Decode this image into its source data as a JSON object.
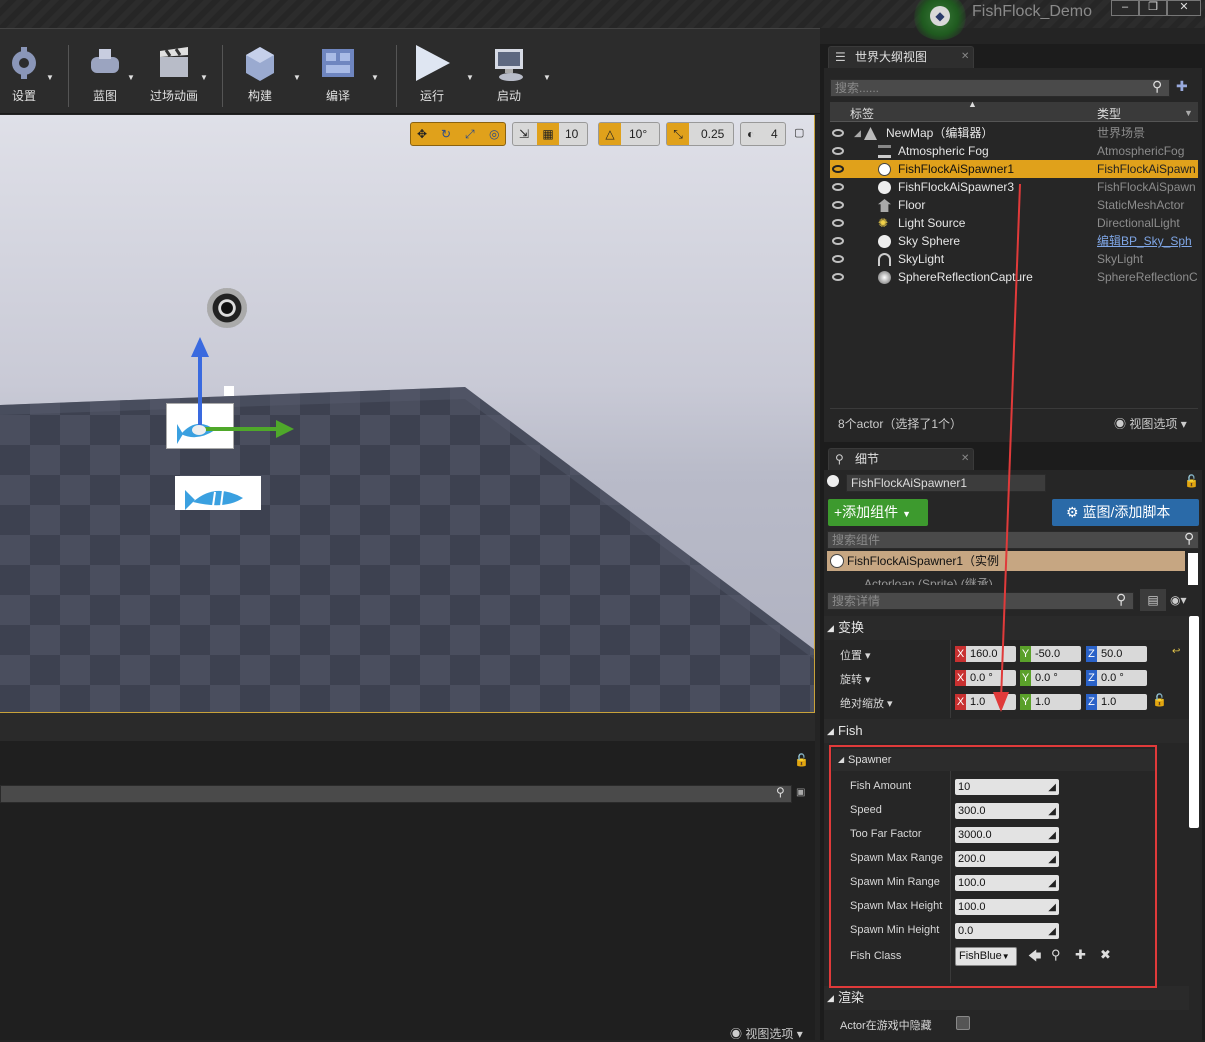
{
  "app": {
    "title": "FishFlock_Demo",
    "controls": [
      "‒",
      "❐",
      "✕"
    ]
  },
  "toolbar": {
    "buttons": [
      {
        "label": "设置",
        "icon": "settings-icon"
      },
      {
        "label": "蓝图",
        "icon": "blueprint-icon"
      },
      {
        "label": "过场动画",
        "icon": "cinematics-icon"
      },
      {
        "label": "构建",
        "icon": "build-icon"
      },
      {
        "label": "编译",
        "icon": "compile-icon"
      },
      {
        "label": "运行",
        "icon": "play-icon"
      },
      {
        "label": "启动",
        "icon": "launch-icon"
      }
    ]
  },
  "viewport": {
    "grid_snap": "10",
    "rotation_snap": "10°",
    "scale_snap": "0.25",
    "camera_speed": "4"
  },
  "outliner": {
    "tab_label": "世界大纲视图",
    "search_placeholder": "搜索......",
    "col_label": "标签",
    "col_type": "类型",
    "items": [
      {
        "name": "NewMap（编辑器）",
        "type": "世界场景"
      },
      {
        "name": "Atmospheric Fog",
        "type": "AtmosphericFog"
      },
      {
        "name": "FishFlockAiSpawner1",
        "type": "FishFlockAiSpawn"
      },
      {
        "name": "FishFlockAiSpawner3",
        "type": "FishFlockAiSpawn"
      },
      {
        "name": "Floor",
        "type": "StaticMeshActor"
      },
      {
        "name": "Light Source",
        "type": "DirectionalLight"
      },
      {
        "name": "Sky Sphere",
        "type": "编辑BP_Sky_Sph"
      },
      {
        "name": "SkyLight",
        "type": "SkyLight"
      },
      {
        "name": "SphereReflectionCapture",
        "type": "SphereReflectionC"
      }
    ],
    "status": "8个actor（选择了1个）",
    "view_options": "视图选项"
  },
  "details": {
    "tab_label": "细节",
    "actor_name": "FishFlockAiSpawner1",
    "add_component": "+添加组件",
    "blueprint_btn": "蓝图/添加脚本",
    "search_components": "搜索组件",
    "component_root": "FishFlockAiSpawner1（实例",
    "component_child": "Actorloan (Sprite) (继承)",
    "search_details": "搜索详情",
    "transform": {
      "section": "变换",
      "location_label": "位置",
      "rotation_label": "旋转",
      "scale_label": "绝对缩放",
      "location": {
        "x": "160.0",
        "y": "-50.0",
        "z": "50.0"
      },
      "rotation": {
        "x": "0.0 °",
        "y": "0.0 °",
        "z": "0.0 °"
      },
      "scale": {
        "x": "1.0",
        "y": "1.0",
        "z": "1.0"
      }
    },
    "fish_section": "Fish",
    "spawner_section": "Spawner",
    "props": [
      {
        "label": "Fish Amount",
        "value": "10"
      },
      {
        "label": "Speed",
        "value": "300.0"
      },
      {
        "label": "Too Far Factor",
        "value": "3000.0"
      },
      {
        "label": "Spawn Max Range",
        "value": "200.0"
      },
      {
        "label": "Spawn Min Range",
        "value": "100.0"
      },
      {
        "label": "Spawn Max Height",
        "value": "100.0"
      },
      {
        "label": "Spawn Min Height",
        "value": "0.0"
      }
    ],
    "fish_class_label": "Fish Class",
    "fish_class_value": "FishBlue",
    "render_section": "渲染",
    "hidden_in_game_label": "Actor在游戏中隐藏"
  },
  "lower": {
    "view_options": "视图选项"
  },
  "colors": {
    "accent": "#e0a11b",
    "highlight_box": "#e03a3a",
    "add_green": "#3d9a2e",
    "blueprint_blue": "#2a6aa8"
  }
}
